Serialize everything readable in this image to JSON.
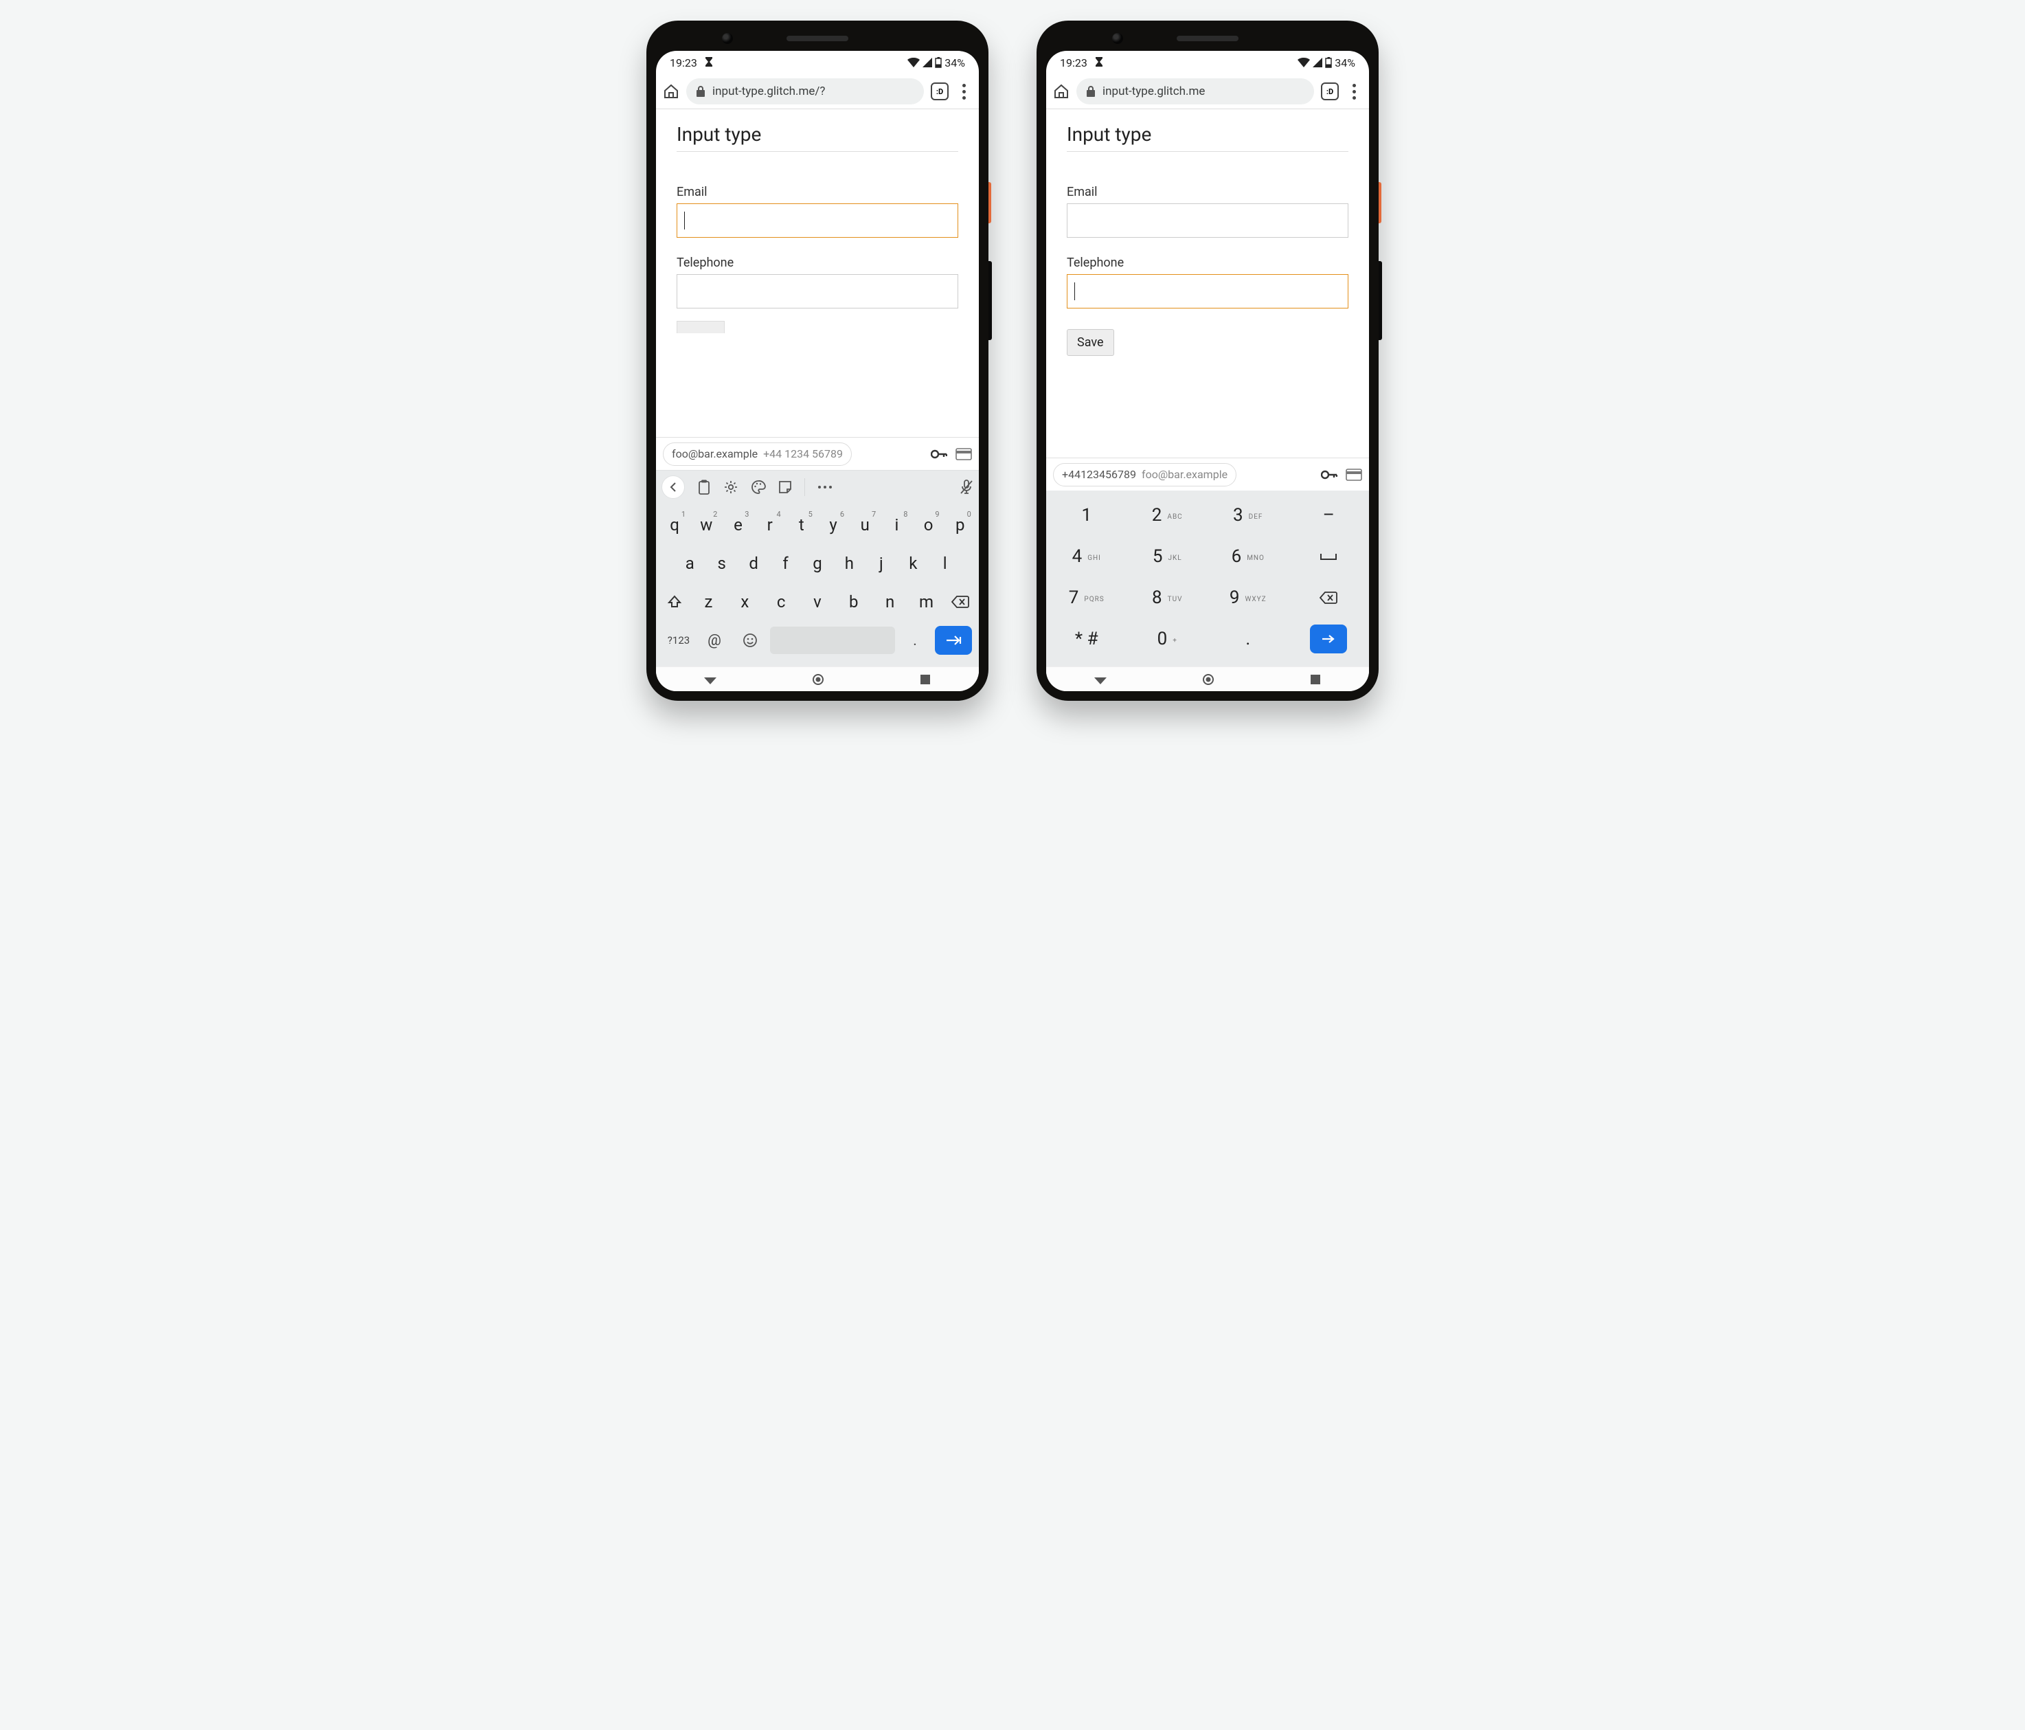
{
  "statusbar": {
    "time": "19:23",
    "battery": "34%"
  },
  "urlbar": {
    "tab_count": ":D"
  },
  "page": {
    "heading": "Input type",
    "email_label": "Email",
    "telephone_label": "Telephone",
    "save_label": "Save"
  },
  "suggestion": {
    "email": "foo@bar.example",
    "phone": "+44 1234 56789",
    "phone_compact": "+44123456789"
  },
  "qwerty": {
    "row1": [
      {
        "k": "q",
        "n": "1"
      },
      {
        "k": "w",
        "n": "2"
      },
      {
        "k": "e",
        "n": "3"
      },
      {
        "k": "r",
        "n": "4"
      },
      {
        "k": "t",
        "n": "5"
      },
      {
        "k": "y",
        "n": "6"
      },
      {
        "k": "u",
        "n": "7"
      },
      {
        "k": "i",
        "n": "8"
      },
      {
        "k": "o",
        "n": "9"
      },
      {
        "k": "p",
        "n": "0"
      }
    ],
    "row2": [
      "a",
      "s",
      "d",
      "f",
      "g",
      "h",
      "j",
      "k",
      "l"
    ],
    "row3": [
      "z",
      "x",
      "c",
      "v",
      "b",
      "n",
      "m"
    ],
    "sym_label": "?123",
    "at_label": "@",
    "period_label": "."
  },
  "numpad": {
    "keys": [
      [
        {
          "n": "1",
          "s": ""
        },
        {
          "n": "2",
          "s": "ABC"
        },
        {
          "n": "3",
          "s": "DEF"
        },
        {
          "n": "–",
          "s": ""
        }
      ],
      [
        {
          "n": "4",
          "s": "GHI"
        },
        {
          "n": "5",
          "s": "JKL"
        },
        {
          "n": "6",
          "s": "MNO"
        },
        {
          "n": "␣",
          "s": ""
        }
      ],
      [
        {
          "n": "7",
          "s": "PQRS"
        },
        {
          "n": "8",
          "s": "TUV"
        },
        {
          "n": "9",
          "s": "WXYZ"
        },
        {
          "n": "⌫",
          "s": ""
        }
      ],
      [
        {
          "n": "* #",
          "s": ""
        },
        {
          "n": "0",
          "s": "+"
        },
        {
          "n": ".",
          "s": ""
        },
        {
          "n": "→",
          "s": ""
        }
      ]
    ]
  },
  "phones": [
    {
      "url": "input-type.glitch.me/?",
      "focused": "email",
      "show_save": false
    },
    {
      "url": "input-type.glitch.me",
      "focused": "telephone",
      "show_save": true
    }
  ]
}
